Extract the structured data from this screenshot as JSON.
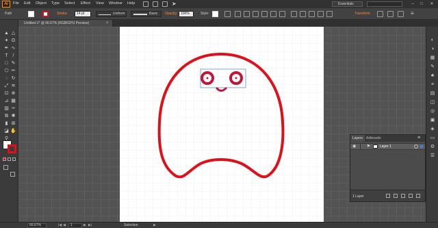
{
  "app": {
    "logo_text": "Ai",
    "menus": [
      "File",
      "Edit",
      "Object",
      "Type",
      "Select",
      "Effect",
      "View",
      "Window",
      "Help"
    ],
    "workspace": "Essentials",
    "window_controls": [
      "–",
      "□",
      "✕"
    ]
  },
  "control_bar": {
    "selection_type": "Path",
    "stroke_label": "Stroke:",
    "stroke_weight": "14 pt",
    "profile": "Uniform",
    "brush": "Basic",
    "opacity_label": "Opacity:",
    "opacity_value": "100%",
    "style_label": "Style:",
    "transform_label": "Transform",
    "colors": {
      "fill": "#ffffff",
      "stroke": "#e0101a",
      "accent": "#ff8a3d"
    }
  },
  "document": {
    "tab_title": "Untitled-1* @ 66.67% (RGB/GPU Preview)",
    "close": "×"
  },
  "tools": [
    "selection-tool",
    "direct-selection-tool",
    "magic-wand-tool",
    "lasso-tool",
    "pen-tool",
    "curvature-tool",
    "type-tool",
    "line-tool",
    "rectangle-tool",
    "paintbrush-tool",
    "shaper-tool",
    "pencil-tool",
    "eraser-tool",
    "rotate-tool",
    "scale-tool",
    "width-tool",
    "free-transform-tool",
    "shape-builder-tool",
    "perspective-tool",
    "mesh-tool",
    "gradient-tool",
    "eyedropper-tool",
    "blend-tool",
    "symbol-sprayer-tool",
    "column-graph-tool",
    "artboard-tool",
    "slice-tool",
    "hand-tool",
    "zoom-tool"
  ],
  "layers_panel": {
    "tabs": [
      "Layers",
      "Artboards"
    ],
    "layer_name": "Layer 1",
    "footer_count": "1 Layer"
  },
  "status_bar": {
    "zoom": "66.67%",
    "artboard_number": "1",
    "tool_name": "Selection"
  }
}
